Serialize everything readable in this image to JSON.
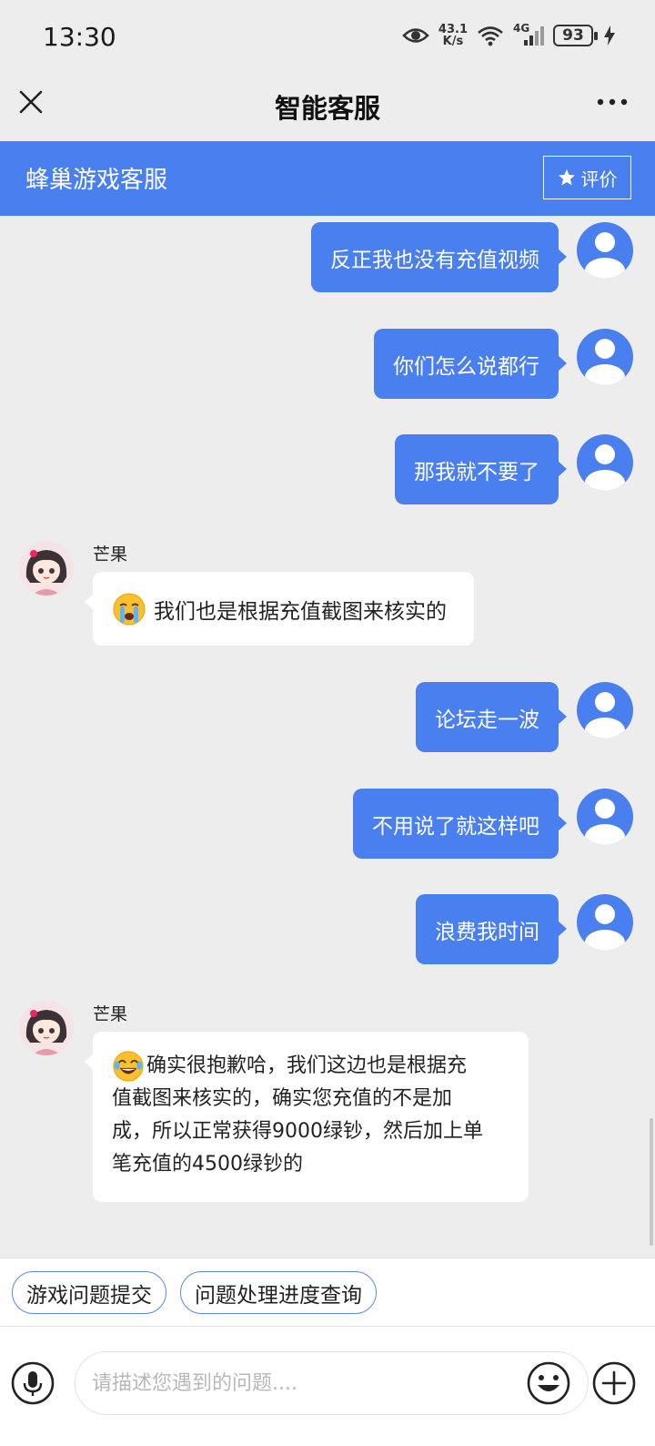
{
  "status_bar": {
    "time": "13:30",
    "net_speed_value": "43.1",
    "net_speed_unit": "K/s",
    "network_type": "4G",
    "battery": "93"
  },
  "title_bar": {
    "title": "智能客服"
  },
  "service_header": {
    "name": "蜂巢游戏客服",
    "rate_label": "评价"
  },
  "messages": [
    {
      "from": "user",
      "text": "反正我也没有充值视频"
    },
    {
      "from": "user",
      "text": "你们怎么说都行"
    },
    {
      "from": "user",
      "text": "那我就不要了"
    },
    {
      "from": "agent",
      "name": "芒果",
      "emoji": "crying-emoji",
      "text": "我们也是根据充值截图来核实的"
    },
    {
      "from": "user",
      "text": "论坛走一波"
    },
    {
      "from": "user",
      "text": "不用说了就这样吧"
    },
    {
      "from": "user",
      "text": "浪费我时间"
    },
    {
      "from": "agent",
      "name": "芒果",
      "emoji": "tears-of-joy-emoji",
      "lines": [
        "确实很抱歉哈，我们这边也是根据充",
        "值截图来核实的，确实您充值的不是加",
        "成，所以正常获得9000绿钞，然后加上单",
        "笔充值的4500绿钞的"
      ]
    }
  ],
  "quick_replies": [
    "游戏问题提交",
    "问题处理进度查询"
  ],
  "input": {
    "placeholder": "请描述您遇到的问题...."
  },
  "colors": {
    "accent": "#4a7ff0",
    "background": "#ededed",
    "bubble_agent": "#ffffff"
  },
  "icons": [
    "eye-icon",
    "wifi-icon",
    "signal-icon",
    "charging-icon",
    "close-icon",
    "more-icon",
    "star-icon",
    "user-avatar-icon",
    "microphone-icon",
    "emoji-icon",
    "plus-icon"
  ]
}
